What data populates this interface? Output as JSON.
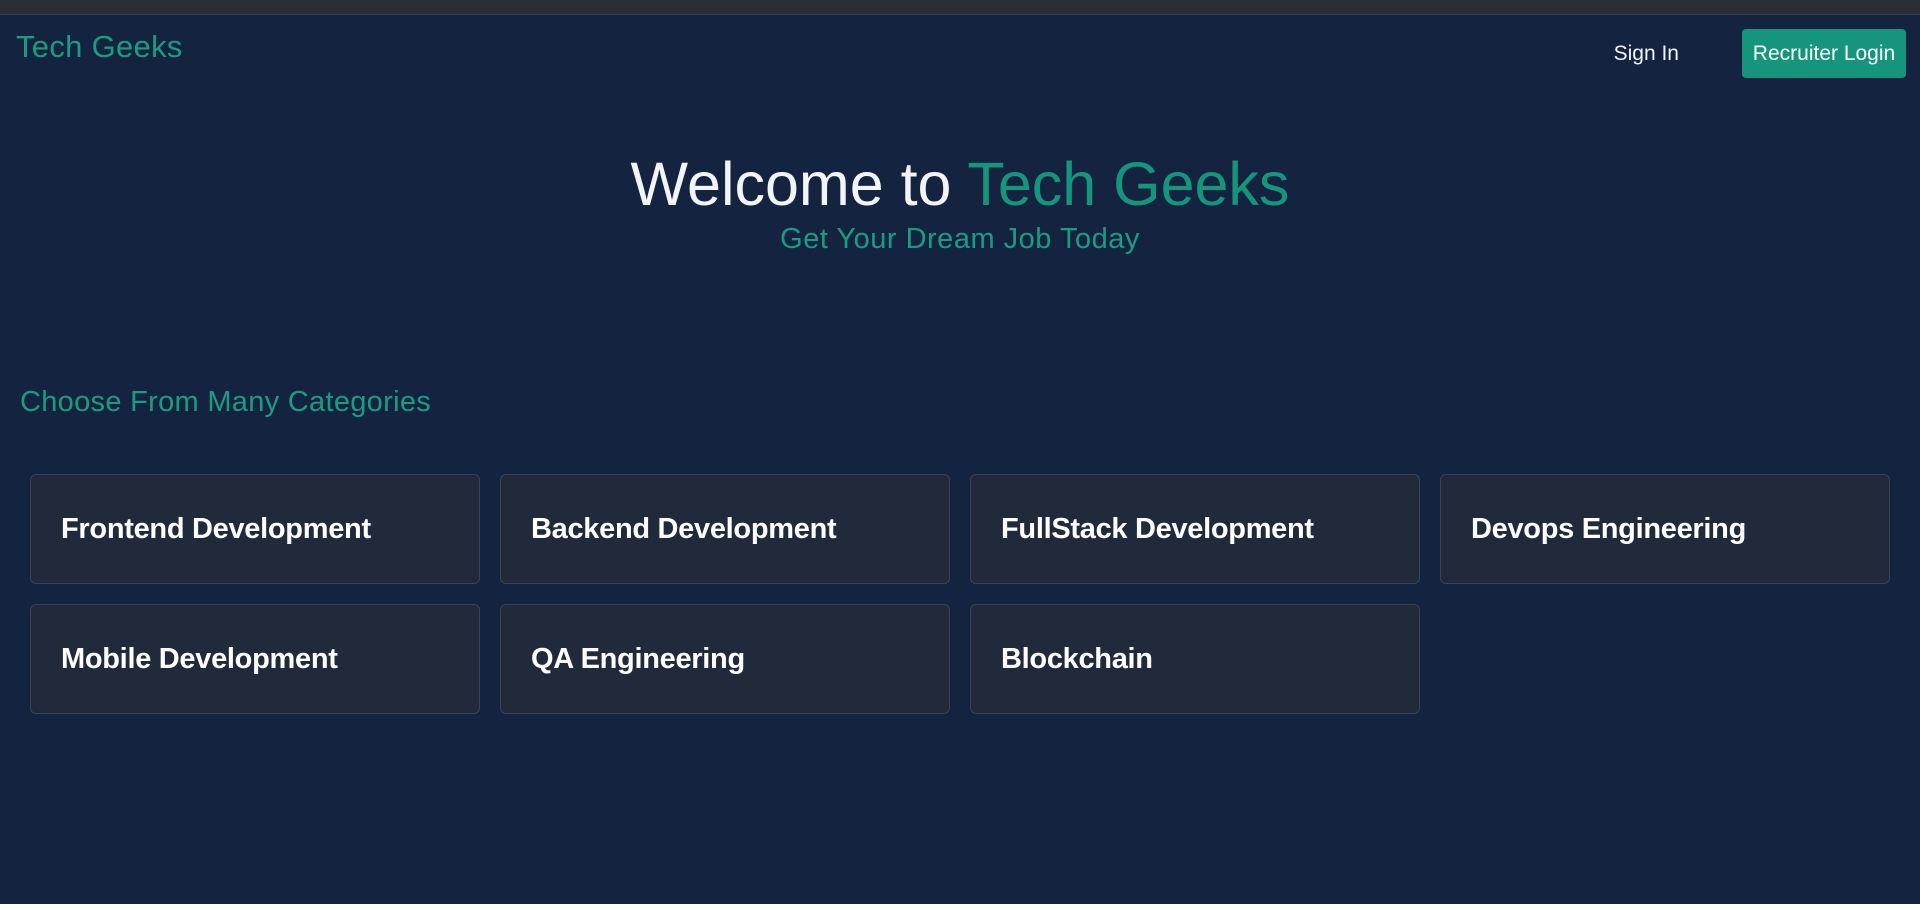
{
  "navbar": {
    "brand": "Tech Geeks",
    "sign_in": "Sign In",
    "recruiter_login": "Recruiter Login"
  },
  "hero": {
    "title_prefix": "Welcome to ",
    "title_accent": "Tech Geeks",
    "subtitle": "Get Your Dream Job Today"
  },
  "categories": {
    "heading": "Choose From Many Categories",
    "items": [
      {
        "label": "Frontend Development"
      },
      {
        "label": "Backend Development"
      },
      {
        "label": "FullStack Development"
      },
      {
        "label": "Devops Engineering"
      },
      {
        "label": "Mobile Development"
      },
      {
        "label": "QA Engineering"
      },
      {
        "label": "Blockchain"
      }
    ]
  },
  "colors": {
    "background": "#142440",
    "accent": "#15967c",
    "card": "#212a3a"
  }
}
